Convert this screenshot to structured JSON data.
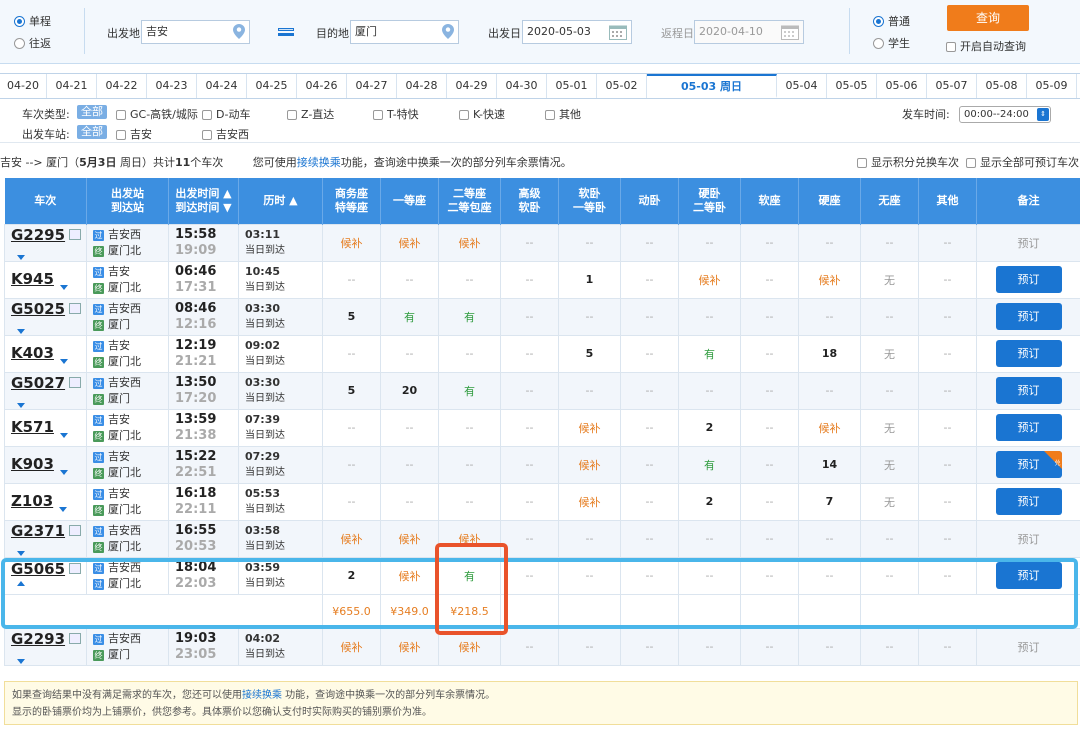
{
  "search": {
    "trip_type": {
      "oneway": "单程",
      "roundtrip": "往返"
    },
    "from_label": "出发地",
    "from_value": "吉安",
    "to_label": "目的地",
    "to_value": "厦门",
    "depart_label": "出发日",
    "depart_value": "2020-05-03",
    "return_label": "返程日",
    "return_value": "2020-04-10",
    "passenger": {
      "normal": "普通",
      "student": "学生"
    },
    "query_button": "查询",
    "auto_query": "开启自动查询"
  },
  "dates": [
    "04-20",
    "04-21",
    "04-22",
    "04-23",
    "04-24",
    "04-25",
    "04-26",
    "04-27",
    "04-28",
    "04-29",
    "04-30",
    "05-01",
    "05-02",
    "05-03 周日",
    "05-04",
    "05-05",
    "05-06",
    "05-07",
    "05-08",
    "05-09"
  ],
  "filters": {
    "type_label": "车次类型:",
    "all": "全部",
    "types": [
      "GC-高铁/城际",
      "D-动车",
      "Z-直达",
      "T-特快",
      "K-快速",
      "其他"
    ],
    "station_label": "出发车站:",
    "stations": [
      "吉安",
      "吉安西"
    ],
    "time_label": "发车时间:",
    "time_value": "00:00--24:00"
  },
  "summary": {
    "route": "吉安 --> 厦门（",
    "date": "5月3日",
    "day": " 周日）共计",
    "count": "11",
    "count_suffix": "个车次",
    "hint_pre": "您可使用",
    "hint_link": "接续换乘",
    "hint_post": "功能，查询途中换乘一次的部分列车余票情况。",
    "opt_points": "显示积分兑换车次",
    "opt_all": "显示全部可预订车次"
  },
  "headers": {
    "train": "车次",
    "station1": "出发站",
    "station2": "到达站",
    "time1": "出发时间 ▲",
    "time2": "到达时间 ▼",
    "duration": "历时 ▲",
    "business1": "商务座",
    "business2": "特等座",
    "first": "一等座",
    "second1": "二等座",
    "second2": "二等包座",
    "hsoft1": "高级",
    "hsoft2": "软卧",
    "soft1": "软卧",
    "soft2": "一等卧",
    "dw": "动卧",
    "hard1": "硬卧",
    "hard2": "二等卧",
    "softseat": "软座",
    "hardseat": "硬座",
    "noseat": "无座",
    "other": "其他",
    "note": "备注"
  },
  "rows": [
    {
      "no": "G2295",
      "from": "吉安西",
      "to": "厦门北",
      "fb": "过",
      "tb": "终",
      "dep": "15:58",
      "arr": "19:09",
      "dur": "03:11",
      "day": "当日到达",
      "seats": [
        "候补",
        "候补",
        "候补",
        "--",
        "--",
        "--",
        "--",
        "--",
        "--",
        "--",
        "--"
      ],
      "action": "预订",
      "bookable": false
    },
    {
      "no": "K945",
      "from": "吉安",
      "to": "厦门北",
      "fb": "过",
      "tb": "终",
      "dep": "06:46",
      "arr": "17:31",
      "dur": "10:45",
      "day": "当日到达",
      "seats": [
        "--",
        "--",
        "--",
        "--",
        "1",
        "--",
        "候补",
        "--",
        "候补",
        "无",
        "--"
      ],
      "action": "预订",
      "bookable": true
    },
    {
      "no": "G5025",
      "from": "吉安西",
      "to": "厦门",
      "fb": "过",
      "tb": "终",
      "dep": "08:46",
      "arr": "12:16",
      "dur": "03:30",
      "day": "当日到达",
      "seats": [
        "5",
        "有",
        "有",
        "--",
        "--",
        "--",
        "--",
        "--",
        "--",
        "--",
        "--"
      ],
      "action": "预订",
      "bookable": true
    },
    {
      "no": "K403",
      "from": "吉安",
      "to": "厦门北",
      "fb": "过",
      "tb": "终",
      "dep": "12:19",
      "arr": "21:21",
      "dur": "09:02",
      "day": "当日到达",
      "seats": [
        "--",
        "--",
        "--",
        "--",
        "5",
        "--",
        "有",
        "--",
        "18",
        "无",
        "--"
      ],
      "action": "预订",
      "bookable": true
    },
    {
      "no": "G5027",
      "from": "吉安西",
      "to": "厦门",
      "fb": "过",
      "tb": "终",
      "dep": "13:50",
      "arr": "17:20",
      "dur": "03:30",
      "day": "当日到达",
      "seats": [
        "5",
        "20",
        "有",
        "--",
        "--",
        "--",
        "--",
        "--",
        "--",
        "--",
        "--"
      ],
      "action": "预订",
      "bookable": true
    },
    {
      "no": "K571",
      "from": "吉安",
      "to": "厦门北",
      "fb": "过",
      "tb": "终",
      "dep": "13:59",
      "arr": "21:38",
      "dur": "07:39",
      "day": "当日到达",
      "seats": [
        "--",
        "--",
        "--",
        "--",
        "候补",
        "--",
        "2",
        "--",
        "候补",
        "无",
        "--"
      ],
      "action": "预订",
      "bookable": true
    },
    {
      "no": "K903",
      "from": "吉安",
      "to": "厦门北",
      "fb": "过",
      "tb": "终",
      "dep": "15:22",
      "arr": "22:51",
      "dur": "07:29",
      "day": "当日到达",
      "seats": [
        "--",
        "--",
        "--",
        "--",
        "候补",
        "--",
        "有",
        "--",
        "14",
        "无",
        "--"
      ],
      "action": "预订",
      "bookable": true,
      "corner": "兑"
    },
    {
      "no": "Z103",
      "from": "吉安",
      "to": "厦门北",
      "fb": "过",
      "tb": "终",
      "dep": "16:18",
      "arr": "22:11",
      "dur": "05:53",
      "day": "当日到达",
      "seats": [
        "--",
        "--",
        "--",
        "--",
        "候补",
        "--",
        "2",
        "--",
        "7",
        "无",
        "--"
      ],
      "action": "预订",
      "bookable": true
    },
    {
      "no": "G2371",
      "from": "吉安西",
      "to": "厦门北",
      "fb": "过",
      "tb": "终",
      "dep": "16:55",
      "arr": "20:53",
      "dur": "03:58",
      "day": "当日到达",
      "seats": [
        "候补",
        "候补",
        "候补",
        "--",
        "--",
        "--",
        "--",
        "--",
        "--",
        "--",
        "--"
      ],
      "action": "预订",
      "bookable": false
    },
    {
      "no": "G5065",
      "from": "吉安西",
      "to": "厦门北",
      "fb": "过",
      "tb": "过",
      "dep": "18:04",
      "arr": "22:03",
      "dur": "03:59",
      "day": "当日到达",
      "seats": [
        "2",
        "候补",
        "有",
        "--",
        "--",
        "--",
        "--",
        "--",
        "--",
        "--",
        "--"
      ],
      "action": "预订",
      "bookable": true,
      "expanded": true,
      "prices": [
        "¥655.0",
        "¥349.0",
        "¥218.5"
      ]
    },
    {
      "no": "G2293",
      "from": "吉安西",
      "to": "厦门",
      "fb": "过",
      "tb": "终",
      "dep": "19:03",
      "arr": "23:05",
      "dur": "04:02",
      "day": "当日到达",
      "seats": [
        "候补",
        "候补",
        "候补",
        "--",
        "--",
        "--",
        "--",
        "--",
        "--",
        "--",
        "--"
      ],
      "action": "预订",
      "bookable": false
    }
  ],
  "footer": {
    "line1_pre": "如果查询结果中没有满足需求的车次，您还可以使用",
    "line1_link": "接续换乘",
    "line1_post": " 功能，查询途中换乘一次的部分列车余票情况。",
    "line2": "显示的卧铺票价均为上铺票价，供您参考。具体票价以您确认支付时实际购买的铺别票价为准。"
  },
  "colors": {
    "accent": "#1a75d2",
    "header": "#3c8fe0",
    "orange": "#f07c1b",
    "green": "#2e9b3d",
    "highlight_blue": "#4ab6ea",
    "highlight_red": "#e9532b"
  }
}
